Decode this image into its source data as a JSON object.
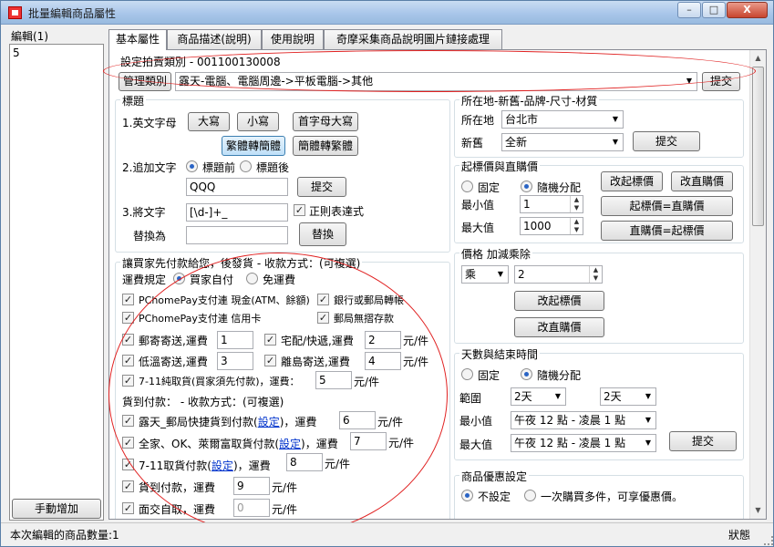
{
  "window": {
    "title": "批量編輯商品屬性",
    "min": "–",
    "max": "□",
    "close": "X"
  },
  "sidebar": {
    "label": "編輯(1)",
    "items": [
      "5"
    ],
    "manual_add": "手動增加"
  },
  "tabs": [
    "基本屬性",
    "商品描述(說明)",
    "使用說明",
    "奇摩采集商品說明圖片鏈接處理"
  ],
  "category": {
    "label": "設定拍賣類別 - 001100130008",
    "manage_btn": "管理類別",
    "value": "露天-電腦、電腦周邊->平板電腦->其他",
    "submit": "提交"
  },
  "title_group": {
    "label": "標題",
    "english_label": "1.英文字母",
    "btn_upper": "大寫",
    "btn_lower": "小寫",
    "btn_capitalize": "首字母大寫",
    "btn_t2s": "繁體轉簡體",
    "btn_s2t": "簡體轉繁體",
    "append_label": "2.追加文字",
    "before": "標題前",
    "after": "標題後",
    "append_value": "QQQ",
    "append_submit": "提交",
    "replace_label": "3.將文字",
    "replace_value": "[\\d-]+_",
    "regex": "正則表達式",
    "replace_with_label": "替換為",
    "replace_btn": "替換"
  },
  "payment": {
    "header": "讓買家先付款給您，後發貨 - 收款方式：(可複選)",
    "shipping_rule": "運費規定",
    "buyer_pays": "買家自付",
    "free_shipping": "免運費",
    "pchome_cash": "PChomePay支付連 現金(ATM、餘額)",
    "bank_transfer": "銀行或郵局轉帳",
    "pchome_card": "PChomePay支付連 信用卡",
    "postal_noreg": "郵局無摺存款",
    "mail": {
      "label": "郵寄寄送,運費",
      "value": "1"
    },
    "home": {
      "label": "宅配/快遞,運費",
      "value": "2",
      "unit": "元/件"
    },
    "cold": {
      "label": "低溫寄送,運費",
      "value": "3"
    },
    "island": {
      "label": "離島寄送,運費",
      "value": "4",
      "unit": "元/件"
    },
    "seven_pay_first": {
      "label": "7-11純取貨(買家須先付款)，運費：",
      "value": "5",
      "unit": "元/件"
    },
    "cod_header": "貨到付款： - 收款方式：(可複選)",
    "post_cod": {
      "label": "露天_郵局快捷貨到付款(",
      "link": "設定",
      "suffix": ")，運費",
      "value": "6",
      "unit": "元/件"
    },
    "family_cod": {
      "label": "全家、OK、萊爾富取貨付款(",
      "link": "設定",
      "suffix": ")，運費",
      "value": "7",
      "unit": "元/件"
    },
    "seven_cod": {
      "label": "7-11取貨付款(",
      "link": "設定",
      "suffix": ")，運費",
      "value": "8",
      "unit": "元/件"
    },
    "cod": {
      "label": "貨到付款，運費",
      "value": "9",
      "unit": "元/件"
    },
    "face": {
      "label": "面交自取，運費",
      "value": "0",
      "unit": "元/件"
    }
  },
  "location": {
    "label": "所在地-新舊-品牌-尺寸-材質",
    "loc_label": "所在地",
    "loc_value": "台北市",
    "cond_label": "新舊",
    "cond_value": "全新",
    "submit": "提交"
  },
  "price": {
    "label": "起標價與直購價",
    "fixed": "固定",
    "random": "隨機分配",
    "min_label": "最小值",
    "min_value": "1",
    "max_label": "最大值",
    "max_value": "1000",
    "btn_start": "改起標價",
    "btn_direct": "改直購價",
    "btn_s2d": "起標價=直購價",
    "btn_d2s": "直購價=起標價"
  },
  "multiply": {
    "label": "價格 加減乘除",
    "op": "乘",
    "value": "2",
    "btn_start": "改起標價",
    "btn_direct": "改直購價"
  },
  "days": {
    "label": "天數與結束時間",
    "fixed": "固定",
    "random": "隨機分配",
    "range_label": "範圍",
    "range_from": "2天",
    "range_to": "2天",
    "min_label": "最小值",
    "min_value": "午夜 12 點 - 凌晨 1 點",
    "max_label": "最大值",
    "max_value": "午夜 12 點 - 凌晨 1 點",
    "submit": "提交"
  },
  "discount": {
    "label": "商品優惠設定",
    "none": "不設定",
    "multi": "一次購買多件，可享優惠價。"
  },
  "status": {
    "left": "本次編輯的商品數量:1",
    "right": "狀態"
  }
}
